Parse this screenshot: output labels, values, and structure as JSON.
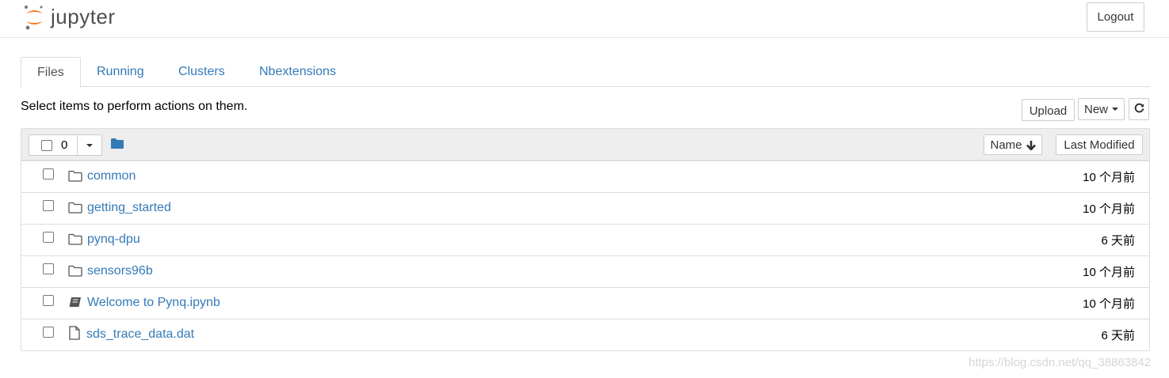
{
  "header": {
    "logo_text": "jupyter",
    "logout_label": "Logout"
  },
  "tabs": [
    {
      "label": "Files",
      "active": true
    },
    {
      "label": "Running",
      "active": false
    },
    {
      "label": "Clusters",
      "active": false
    },
    {
      "label": "Nbextensions",
      "active": false
    }
  ],
  "toolbar": {
    "hint": "Select items to perform actions on them.",
    "upload_label": "Upload",
    "new_label": "New",
    "refresh_icon": "refresh-icon"
  },
  "list": {
    "selected_count": "0",
    "sort_name_label": "Name",
    "sort_icon": "arrow-down-icon",
    "last_modified_label": "Last Modified",
    "items": [
      {
        "name": "common",
        "modified": "10 个月前",
        "icon": "folder-icon"
      },
      {
        "name": "getting_started",
        "modified": "10 个月前",
        "icon": "folder-icon"
      },
      {
        "name": "pynq-dpu",
        "modified": "6 天前",
        "icon": "folder-icon"
      },
      {
        "name": "sensors96b",
        "modified": "10 个月前",
        "icon": "folder-icon"
      },
      {
        "name": "Welcome to Pynq.ipynb",
        "modified": "10 个月前",
        "icon": "notebook-icon"
      },
      {
        "name": "sds_trace_data.dat",
        "modified": "6 天前",
        "icon": "file-icon"
      }
    ]
  },
  "watermark": "https://blog.csdn.net/qq_38863842",
  "colors": {
    "link": "#337ab7",
    "logo_orange": "#f37726",
    "header_bg": "#eeeeee"
  }
}
